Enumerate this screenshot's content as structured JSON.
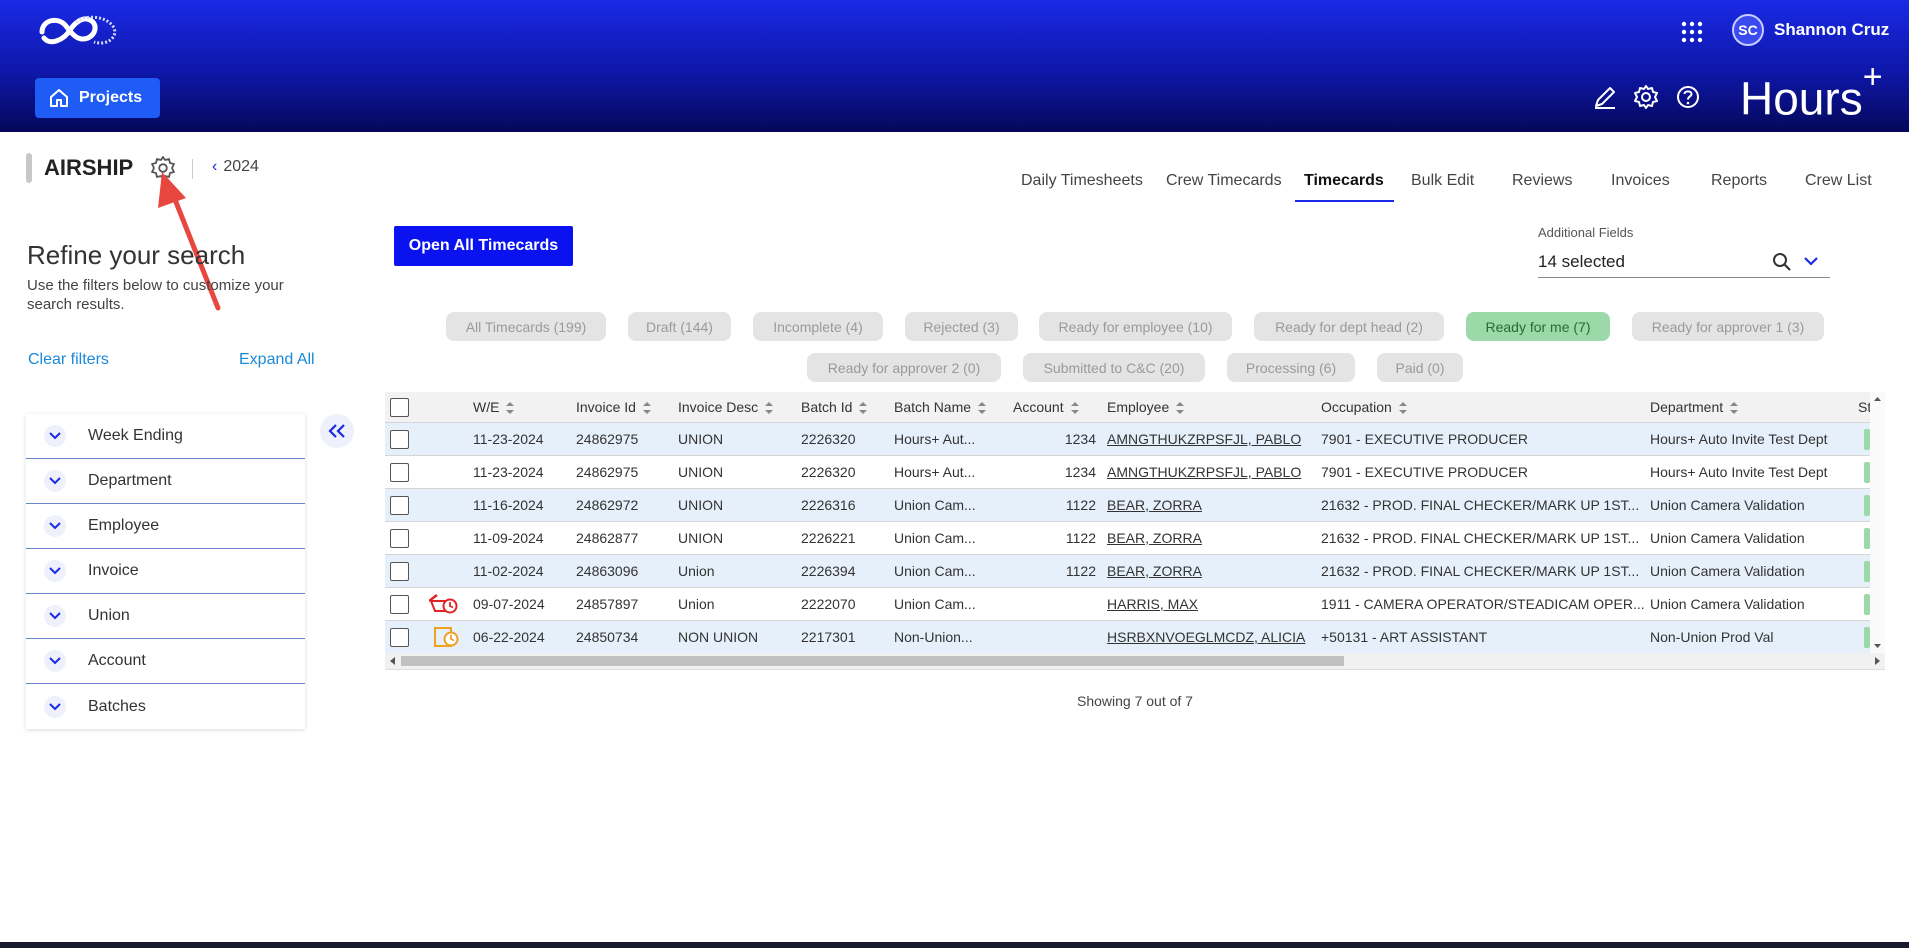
{
  "header": {
    "user_initials": "SC",
    "user_name": "Shannon Cruz",
    "projects_label": "Projects",
    "brand": "Hours",
    "brand_plus": "+"
  },
  "project": {
    "name": "AIRSHIP",
    "year": "2024"
  },
  "tabs": [
    "Daily Timesheets",
    "Crew Timecards",
    "Timecards",
    "Bulk Edit",
    "Reviews",
    "Invoices",
    "Reports",
    "Crew List"
  ],
  "active_tab": "Timecards",
  "sidebar": {
    "title": "Refine your search",
    "subtitle": "Use the filters below to customize your search results.",
    "clear_filters": "Clear filters",
    "expand_all": "Expand All",
    "filters": [
      "Week Ending",
      "Department",
      "Employee",
      "Invoice",
      "Union",
      "Account",
      "Batches"
    ]
  },
  "main": {
    "open_all_label": "Open All Timecards",
    "additional_fields_label": "Additional Fields",
    "additional_fields_value": "14 selected",
    "status_chips": [
      "All Timecards (199)",
      "Draft (144)",
      "Incomplete (4)",
      "Rejected (3)",
      "Ready for employee (10)",
      "Ready for dept head (2)",
      "Ready for me (7)",
      "Ready for approver 1 (3)",
      "Ready for approver 2 (0)",
      "Submitted to C&C (20)",
      "Processing (6)",
      "Paid (0)"
    ],
    "active_chip": "Ready for me (7)",
    "showing": "Showing 7 out of 7"
  },
  "table": {
    "columns": [
      "W/E",
      "Invoice Id",
      "Invoice Desc",
      "Batch Id",
      "Batch Name",
      "Account",
      "Employee",
      "Occupation",
      "Department",
      "St"
    ],
    "rows": [
      {
        "we": "11-23-2024",
        "invoice_id": "24862975",
        "invoice_desc": "UNION",
        "batch_id": "2226320",
        "batch_name": "Hours+ Aut...",
        "account": "1234",
        "employee": "AMNGTHUKZRPSFJL, PABLO",
        "occupation": "7901 - EXECUTIVE PRODUCER",
        "department": "Hours+ Auto Invite Test Dept",
        "icon": ""
      },
      {
        "we": "11-23-2024",
        "invoice_id": "24862975",
        "invoice_desc": "UNION",
        "batch_id": "2226320",
        "batch_name": "Hours+ Aut...",
        "account": "1234",
        "employee": "AMNGTHUKZRPSFJL, PABLO",
        "occupation": "7901 - EXECUTIVE PRODUCER",
        "department": "Hours+ Auto Invite Test Dept",
        "icon": ""
      },
      {
        "we": "11-16-2024",
        "invoice_id": "24862972",
        "invoice_desc": "UNION",
        "batch_id": "2226316",
        "batch_name": "Union Cam...",
        "account": "1122",
        "employee": "BEAR, ZORRA",
        "occupation": "21632 - PROD. FINAL CHECKER/MARK UP 1ST...",
        "department": "Union Camera Validation",
        "icon": ""
      },
      {
        "we": "11-09-2024",
        "invoice_id": "24862877",
        "invoice_desc": "UNION",
        "batch_id": "2226221",
        "batch_name": "Union Cam...",
        "account": "1122",
        "employee": "BEAR, ZORRA",
        "occupation": "21632 - PROD. FINAL CHECKER/MARK UP 1ST...",
        "department": "Union Camera Validation",
        "icon": ""
      },
      {
        "we": "11-02-2024",
        "invoice_id": "24863096",
        "invoice_desc": "Union",
        "batch_id": "2226394",
        "batch_name": "Union Cam...",
        "account": "1122",
        "employee": "BEAR, ZORRA",
        "occupation": "21632 - PROD. FINAL CHECKER/MARK UP 1ST...",
        "department": "Union Camera Validation",
        "icon": ""
      },
      {
        "we": "09-07-2024",
        "invoice_id": "24857897",
        "invoice_desc": "Union",
        "batch_id": "2222070",
        "batch_name": "Union Cam...",
        "account": "",
        "employee": "HARRIS, MAX",
        "occupation": "1911 - CAMERA OPERATOR/STEADICAM OPER...",
        "department": "Union Camera Validation",
        "icon": "late-red"
      },
      {
        "we": "06-22-2024",
        "invoice_id": "24850734",
        "invoice_desc": "NON UNION",
        "batch_id": "2217301",
        "batch_name": "Non-Union...",
        "account": "",
        "employee": "HSRBXNVOEGLMCDZ, ALICIA",
        "occupation": "+50131 - ART ASSISTANT",
        "department": "Non-Union Prod Val",
        "icon": "late-orange"
      }
    ]
  },
  "colors": {
    "header_top": "#1a2ae6",
    "header_bottom": "#05085a",
    "accent_blue": "#0a12f0",
    "link_blue": "#1a8ad9",
    "chip_active": "#9bd9a8",
    "row_alt": "#e6f0fb",
    "annotation_arrow": "#e8473f"
  },
  "icons": [
    "logo-icon",
    "apps-grid-icon",
    "home-icon",
    "pencil-icon",
    "gear-icon",
    "help-icon",
    "chevron-left-icon",
    "chevron-down-icon",
    "double-chevron-left-icon",
    "search-icon",
    "sort-icon",
    "late-timecard-icon"
  ]
}
